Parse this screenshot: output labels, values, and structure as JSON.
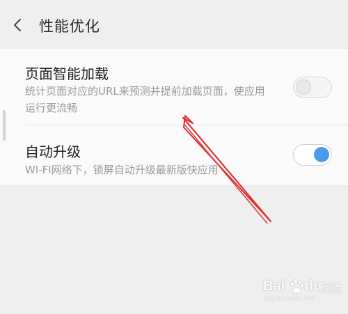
{
  "header": {
    "title": "性能优化",
    "back_icon": "chevron-left-icon"
  },
  "settings": [
    {
      "title": "页面智能加载",
      "description": "统计页面对应的URL来预测并提前加载页面，使应用运行更流畅",
      "enabled": false
    },
    {
      "title": "自动升级",
      "description": "WI-FI网络下，锁屏自动升级最新版快应用",
      "enabled": true
    }
  ],
  "watermark": {
    "brand_left": "Bai",
    "brand_right": "du",
    "suffix": "经验",
    "url": "jingyan.baidu.com"
  },
  "colors": {
    "toggle_on": "#4a9bea",
    "annotation_arrow": "#e03030",
    "background": "#efeff0",
    "card": "#fafafa"
  }
}
